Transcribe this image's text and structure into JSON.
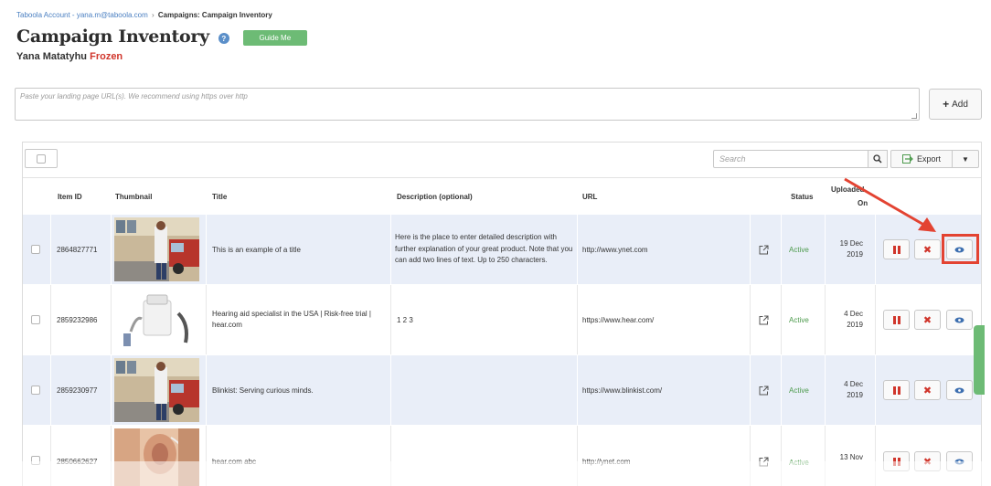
{
  "breadcrumb": {
    "account": "Taboola Account - yana.m@taboola.com",
    "separator": "›",
    "current": "Campaigns: Campaign Inventory"
  },
  "page": {
    "title": "Campaign Inventory",
    "help": "?",
    "guide_button": "Guide Me",
    "account_name": "Yana Matatyhu",
    "account_status": "Frozen"
  },
  "url_input": {
    "placeholder": "Paste your landing page URL(s). We recommend using https over http"
  },
  "add_button": "Add",
  "toolbar": {
    "search_placeholder": "Search",
    "export_label": "Export"
  },
  "table": {
    "columns": {
      "item_id": "Item ID",
      "thumbnail": "Thumbnail",
      "title": "Title",
      "description": "Description (optional)",
      "url": "URL",
      "status": "Status",
      "uploaded_line1": "Uploaded",
      "uploaded_line2": "On"
    },
    "rows": [
      {
        "item_id": "2864827771",
        "title": "This is an example of a title",
        "description": "Here is the place to enter detailed description with further explanation of your great product. Note that you can add two lines of text. Up to 250 characters.",
        "url": "http://www.ynet.com",
        "status": "Active",
        "date_line1": "19 Dec",
        "date_line2": "2019"
      },
      {
        "item_id": "2859232986",
        "title": "Hearing aid specialist in the USA | Risk-free trial | hear.com",
        "description": "1 2 3",
        "url": "https://www.hear.com/",
        "status": "Active",
        "date_line1": "4 Dec",
        "date_line2": "2019"
      },
      {
        "item_id": "2859230977",
        "title": "Blinkist: Serving curious minds.",
        "description": "",
        "url": "https://www.blinkist.com/",
        "status": "Active",
        "date_line1": "4 Dec",
        "date_line2": "2019"
      },
      {
        "item_id": "2850662627",
        "title": "hear.com abc",
        "description": "",
        "url": "http://ynet.com",
        "status": "Active",
        "date_line1": "13 Nov",
        "date_line2": ""
      }
    ]
  },
  "colors": {
    "link_blue": "#4a7fc1",
    "frozen_red": "#d0352b",
    "guide_green": "#6dbb75",
    "active_green": "#4c9a4c",
    "row_shade": "#e9eef8",
    "highlight_red": "#e34332"
  }
}
